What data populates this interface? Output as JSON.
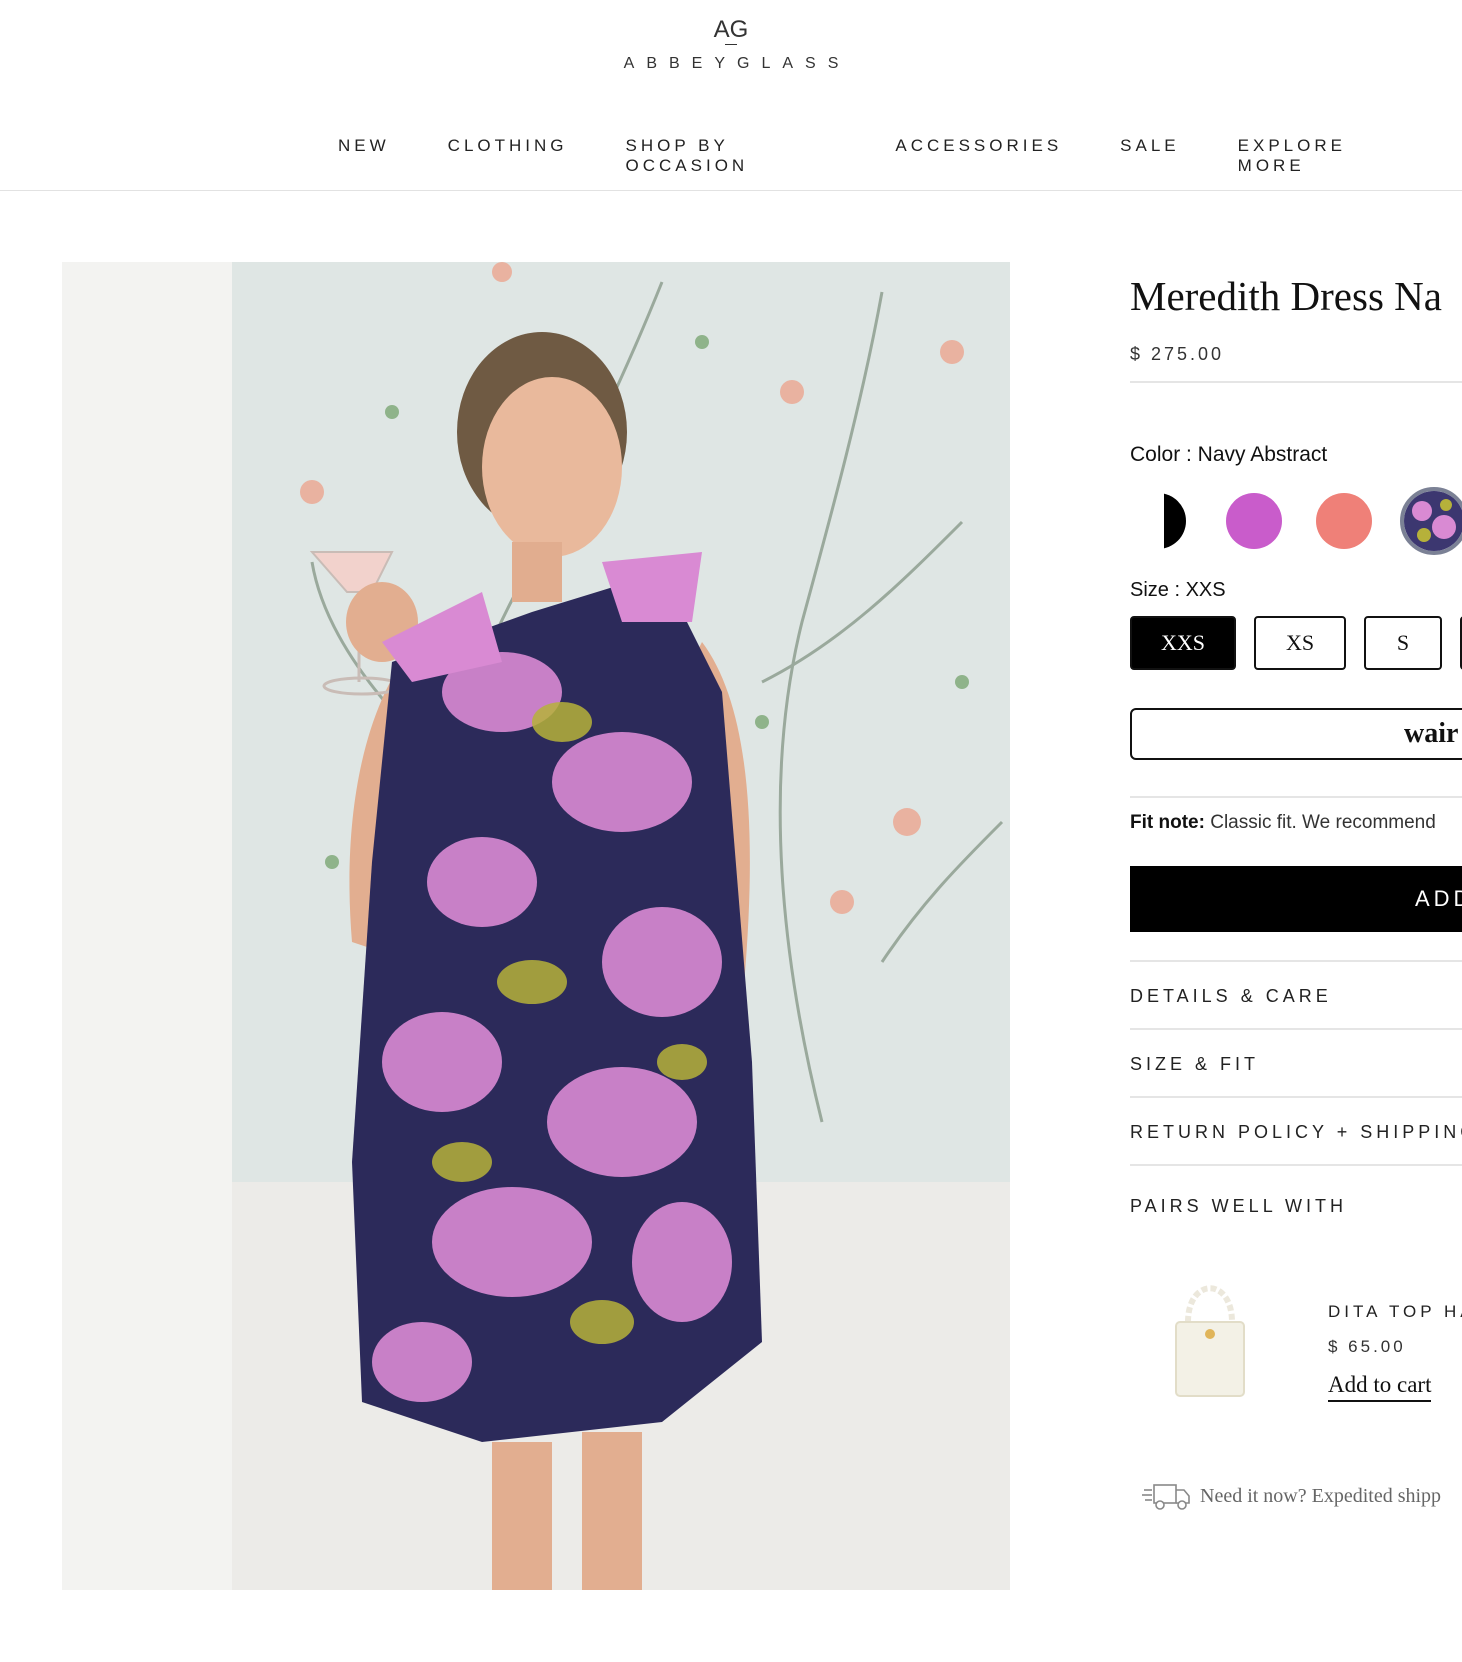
{
  "brand": {
    "mark": "AG",
    "word": "ABBEYGLASS"
  },
  "nav": [
    "NEW",
    "CLOTHING",
    "SHOP BY OCCASION",
    "ACCESSORIES",
    "SALE",
    "EXPLORE MORE"
  ],
  "product": {
    "title": "Meredith Dress Na",
    "price": "$ 275.00",
    "color_label": "Color : Navy Abstract",
    "swatch_colors": [
      "#000000",
      "#c95ccb",
      "#ef8078",
      "#3c3770"
    ],
    "size_label": "Size : XXS",
    "sizes": [
      "XXS",
      "XS",
      "S"
    ],
    "selected_size": "XXS",
    "wair_text": "wair",
    "fit_note_label": "Fit note:",
    "fit_note_text": " Classic fit. We recommend",
    "add_to_cart": "ADD"
  },
  "accordions": [
    "DETAILS & CARE",
    "SIZE & FIT",
    "RETURN POLICY + SHIPPING P"
  ],
  "pairs": {
    "heading": "PAIRS WELL WITH",
    "item_name": "DITA TOP HA",
    "item_price": "$ 65.00",
    "item_add": "Add to cart"
  },
  "shipping_note": "Need it now? Expedited shipp"
}
